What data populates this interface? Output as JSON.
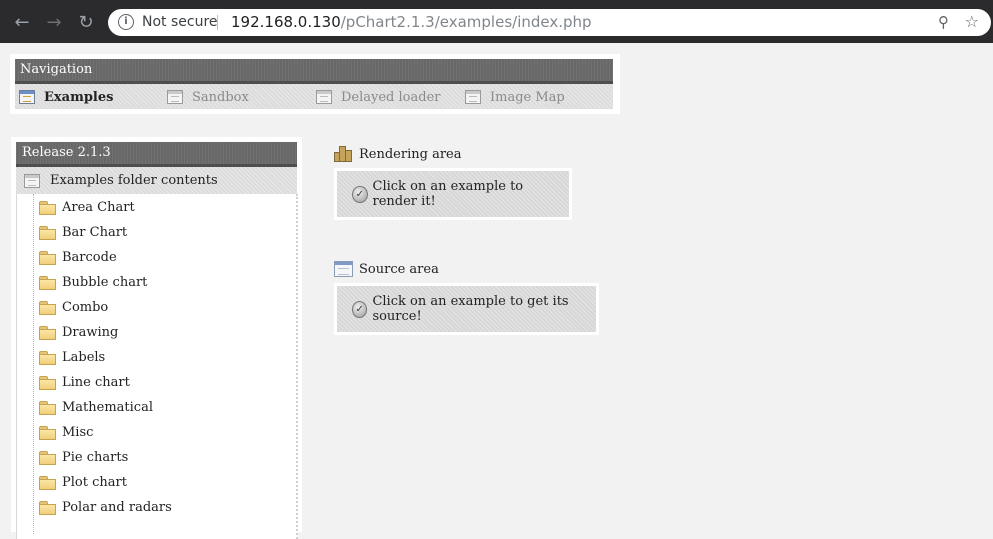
{
  "browser": {
    "back_icon": "arrow-left-icon",
    "forward_icon": "arrow-right-icon",
    "reload_icon": "reload-icon",
    "security_label": "Not secure",
    "url_host": "192.168.0.130",
    "url_path": "/pChart2.1.3/examples/index.php"
  },
  "navigation": {
    "title": "Navigation",
    "items": [
      {
        "label": "Examples",
        "active": true
      },
      {
        "label": "Sandbox",
        "active": false
      },
      {
        "label": "Delayed loader",
        "active": false
      },
      {
        "label": "Image Map",
        "active": false
      }
    ]
  },
  "release": {
    "title": "Release 2.1.3",
    "folder_header": "Examples folder contents",
    "folders": [
      "Area Chart",
      "Bar Chart",
      "Barcode",
      "Bubble chart",
      "Combo",
      "Drawing",
      "Labels",
      "Line chart",
      "Mathematical",
      "Misc",
      "Pie charts",
      "Plot chart",
      "Polar and radars"
    ]
  },
  "rendering": {
    "title": "Rendering area",
    "message": "Click on an example to render it!"
  },
  "source": {
    "title": "Source area",
    "message": "Click on an example to get its source!"
  }
}
